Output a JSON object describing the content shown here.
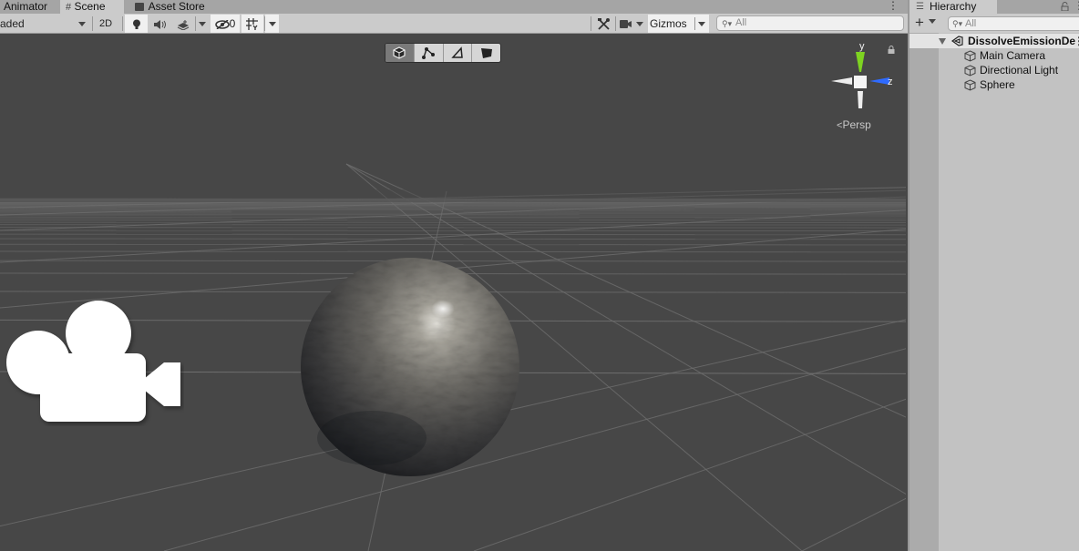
{
  "tabs": {
    "items": [
      {
        "label": "Animator",
        "active": false
      },
      {
        "label": "Scene",
        "active": true,
        "icon": "hash-icon"
      },
      {
        "label": "Asset Store",
        "active": false,
        "icon": "bag-icon"
      }
    ],
    "more_glyph": "⋮"
  },
  "toolbar": {
    "draw_mode": "Shaded",
    "draw_mode_visible": "aded",
    "toggle_2d": "2D",
    "lighting_icon": "lightbulb-icon",
    "audio_icon": "speaker-icon",
    "effects_icon": "effects-icon",
    "hidden_count": "0",
    "grid_icon": "grid-icon",
    "tools_icon": "tools-icon",
    "camera_icon": "camera-icon",
    "gizmos_label": "Gizmos",
    "search_placeholder": "All"
  },
  "viewport": {
    "tool_modes": [
      {
        "name": "cube-mode",
        "active": true
      },
      {
        "name": "nodes-mode",
        "active": false
      },
      {
        "name": "triangle-mode",
        "active": false
      },
      {
        "name": "shape-mode",
        "active": false
      }
    ],
    "gizmo": {
      "y_label": "y",
      "z_label": "z",
      "projection": "Persp",
      "projection_glyph": "<",
      "colors": {
        "y": "#7ed321",
        "z": "#2f6bff",
        "neutral": "#f2f2f2"
      }
    },
    "objects": {
      "camera_icon": "movie-camera-icon",
      "sphere": "textured-sphere"
    },
    "colors": {
      "background": "#474747",
      "grid": "#6e6e6e"
    }
  },
  "hierarchy": {
    "title": "Hierarchy",
    "add_glyph": "+",
    "search_placeholder": "All",
    "scene_name": "DissolveEmissionDemo",
    "scene_name_visible": "DissolveEmissionDe",
    "items": [
      {
        "label": "Main Camera"
      },
      {
        "label": "Directional Light"
      },
      {
        "label": "Sphere"
      }
    ]
  }
}
